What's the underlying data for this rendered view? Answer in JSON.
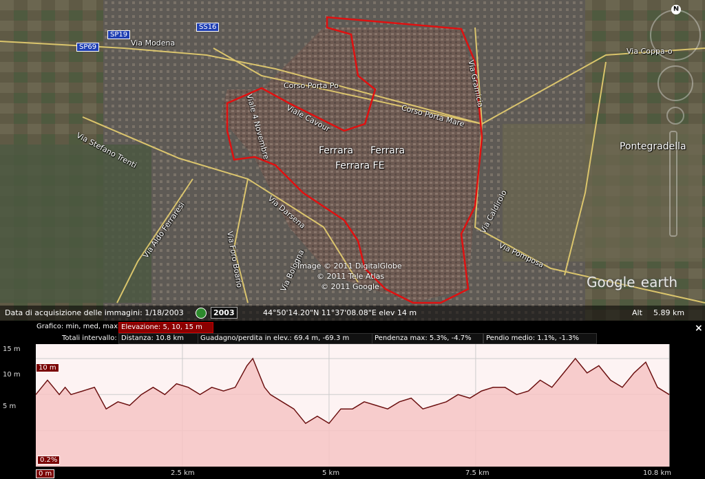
{
  "map": {
    "roads": [
      "Via Modena",
      "Via Coppa-o",
      "Via Stefano Trenti",
      "Via Aldo Ferraresi",
      "Viale Cavour",
      "Corso Porta Po",
      "Corso Porta Mare",
      "Via Gramicia",
      "Via Caldirolo",
      "Via Pomposa",
      "Via Darsena",
      "Via Bologna",
      "Via Foro Boario",
      "Viale 4 Novembre"
    ],
    "shields": [
      "SP69",
      "SP19",
      "SS16"
    ],
    "places": [
      "Ferrara",
      "Ferrara",
      "Ferrara FE",
      "Pontegradella"
    ],
    "credits": [
      "Image © 2011 DigitalGlobe",
      "© 2011 Tele Atlas",
      "© 2011 Google"
    ],
    "logo_main": "Google",
    "logo_sub": "earth",
    "compass": "N"
  },
  "status": {
    "date_label": "Data di acquisizione delle immagini: 1/18/2003",
    "year": "2003",
    "coords": "44°50'14.20\"N  11°37'08.08\"E  elev    14 m",
    "alt_label": "Alt",
    "alt_value": "5.89 km"
  },
  "profile": {
    "graph_label": "Grafico: min, med, max:",
    "elev_box": "Elevazione: 5, 10, 15 m",
    "totals_label": "Totali intervallo:",
    "distance": "Distanza: 10.8 km",
    "gain": "Guadagno/perdita in elev.: 69.4 m, -69.3 m",
    "max_slope": "Pendenza max: 5.3%, -4.7%",
    "avg_slope": "Pendio medio: 1.1%, -1.3%",
    "close": "×",
    "y_ticks": [
      "15 m",
      "10 m",
      "5 m"
    ],
    "x_ticks": [
      "0 m",
      "2.5 km",
      "5 km",
      "7.5 km",
      "10.8 km"
    ],
    "cursor_elev": "10 m",
    "cursor_slope": "0.2%"
  },
  "chart_data": {
    "type": "area",
    "xlabel": "",
    "ylabel": "",
    "xlim": [
      0,
      10.8
    ],
    "ylim": [
      0,
      17
    ],
    "x": [
      0,
      0.1,
      0.2,
      0.3,
      0.4,
      0.5,
      0.6,
      0.8,
      1.0,
      1.2,
      1.4,
      1.6,
      1.8,
      2.0,
      2.2,
      2.4,
      2.6,
      2.8,
      3.0,
      3.2,
      3.4,
      3.6,
      3.7,
      3.8,
      3.9,
      4.0,
      4.2,
      4.4,
      4.6,
      4.8,
      5.0,
      5.2,
      5.4,
      5.6,
      5.8,
      6.0,
      6.2,
      6.4,
      6.6,
      6.8,
      7.0,
      7.2,
      7.4,
      7.6,
      7.8,
      8.0,
      8.2,
      8.4,
      8.6,
      8.8,
      9.0,
      9.2,
      9.4,
      9.6,
      9.8,
      10.0,
      10.2,
      10.4,
      10.6,
      10.8
    ],
    "series": [
      {
        "values": [
          10,
          11,
          12,
          11,
          10,
          11,
          10,
          10.5,
          11,
          8,
          9,
          8.5,
          10,
          11,
          10,
          11.5,
          11,
          10,
          11,
          10.5,
          11,
          14,
          15,
          13,
          11,
          10,
          9,
          8,
          6,
          7,
          6,
          8,
          8,
          9,
          8.5,
          8,
          9,
          9.5,
          8,
          8.5,
          9,
          10,
          9.5,
          10.5,
          11,
          11,
          10,
          10.5,
          12,
          11,
          13,
          15,
          13,
          14,
          12,
          11,
          13,
          14.5,
          11,
          10
        ]
      }
    ]
  }
}
